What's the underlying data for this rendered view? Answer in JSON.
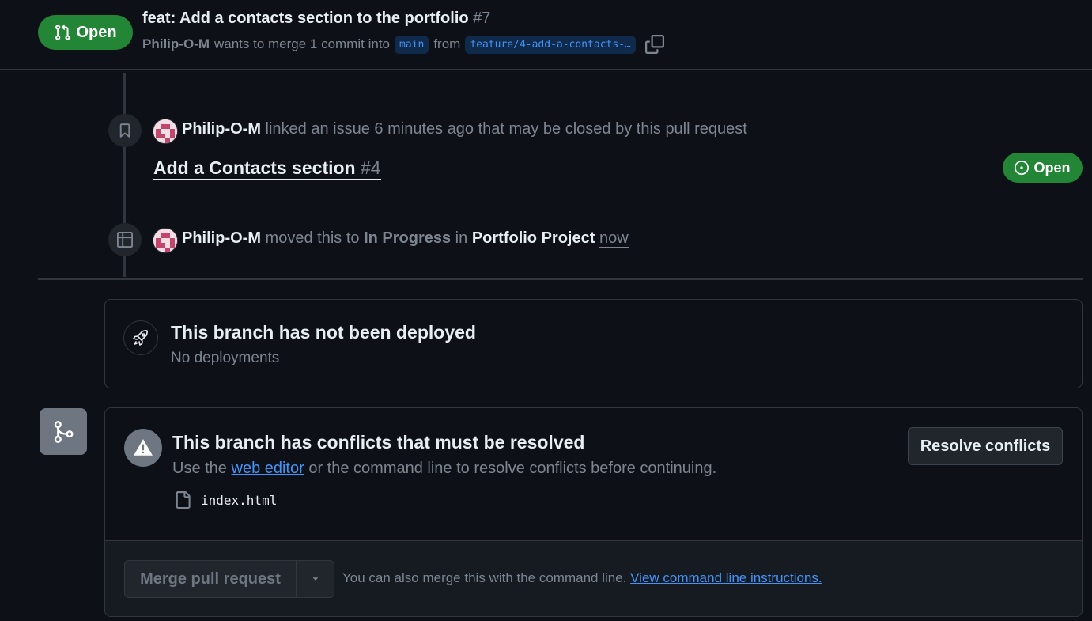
{
  "header": {
    "state_label": "Open",
    "title": "feat: Add a contacts section to the portfolio",
    "number": "#7",
    "author": "Philip-O-M",
    "merge_text": "wants to merge 1 commit into",
    "base_branch": "main",
    "from_text": "from",
    "head_branch": "feature/4-add-a-contacts-…"
  },
  "timeline": {
    "event1": {
      "actor": "Philip-O-M",
      "verb": "linked an issue",
      "time": "6 minutes ago",
      "text1": "that may be",
      "closed": "closed",
      "text2": "by this pull request",
      "issue_title": "Add a Contacts section",
      "issue_number": "#4",
      "issue_state": "Open"
    },
    "event2": {
      "actor": "Philip-O-M",
      "verb": "moved this to",
      "column": "In Progress",
      "in_text": "in",
      "project": "Portfolio Project",
      "time": "now"
    }
  },
  "deployment": {
    "title": "This branch has not been deployed",
    "subtitle": "No deployments"
  },
  "conflicts": {
    "title": "This branch has conflicts that must be resolved",
    "sub_prefix": "Use the",
    "sub_link": "web editor",
    "sub_suffix": "or the command line to resolve conflicts before continuing.",
    "file": "index.html",
    "resolve_label": "Resolve conflicts"
  },
  "merge": {
    "button_label": "Merge pull request",
    "note": "You can also merge this with the command line.",
    "note_link": "View command line instructions."
  },
  "colors": {
    "background": "#0d1117",
    "open_green": "#238636",
    "link_blue": "#4493f8",
    "muted": "#7d8590"
  }
}
